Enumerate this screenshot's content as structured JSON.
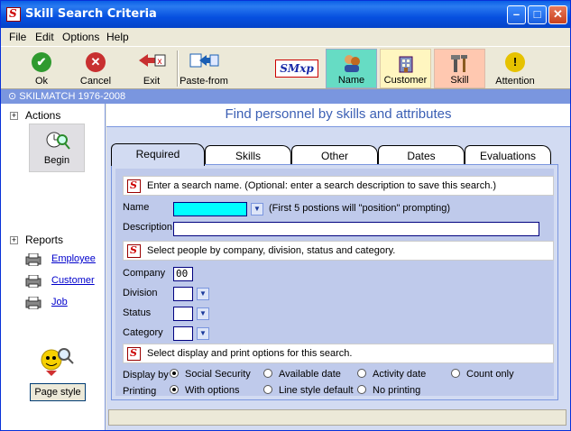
{
  "window": {
    "title": "Skill Search Criteria"
  },
  "menu": {
    "items": [
      "File",
      "Edit",
      "Options",
      "Help"
    ]
  },
  "toolbar": {
    "ok": "Ok",
    "cancel": "Cancel",
    "exit": "Exit",
    "paste_from": "Paste-from",
    "logo": "SMxp",
    "name": "Name",
    "customer": "Customer",
    "skill": "Skill",
    "attention": "Attention"
  },
  "statusline": "SKILMATCH 1976-2008",
  "sidebar": {
    "actions": "Actions",
    "begin": "Begin",
    "reports": "Reports",
    "report_links": [
      "Employee",
      "Customer",
      "Job"
    ],
    "page_style": "Page style"
  },
  "main": {
    "header": "Find personnel by skills and attributes",
    "tabs": [
      "Required",
      "Skills",
      "Other",
      "Dates",
      "Evaluations"
    ],
    "info1": "Enter a search name.  (Optional: enter a search description to save this search.)",
    "name_label": "Name",
    "name_value": "",
    "name_hint": "(First 5 postions will \"position\" prompting)",
    "description_label": "Description",
    "description_value": "",
    "info2": "Select people by company, division, status and category.",
    "company_label": "Company",
    "company_value": "00",
    "division_label": "Division",
    "status_label": "Status",
    "category_label": "Category",
    "info3": "Select display and print options for this search.",
    "display_label": "Display by",
    "display_options": [
      "Social Security",
      "Available date",
      "Activity date",
      "Count only"
    ],
    "display_selected": "Social Security",
    "printing_label": "Printing",
    "printing_options": [
      "With options",
      "Line style default",
      "No printing"
    ],
    "printing_selected": "With options"
  },
  "colors": {
    "accent": "#3b5fb4",
    "name_field": "#00ffff",
    "panel": "#bfcaeb"
  }
}
